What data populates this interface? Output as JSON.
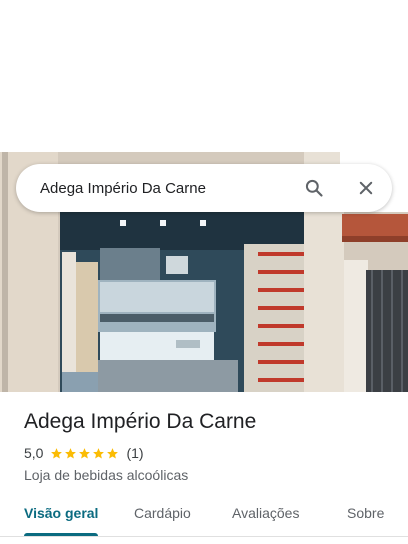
{
  "search": {
    "query": "Adega Império Da Carne"
  },
  "place": {
    "title": "Adega Império Da Carne",
    "rating": "5,0",
    "stars": 5,
    "review_count": "(1)",
    "category": "Loja de bebidas alcoólicas"
  },
  "tabs": [
    {
      "label": "Visão geral",
      "active": true
    },
    {
      "label": "Cardápio",
      "active": false
    },
    {
      "label": "Avaliações",
      "active": false
    },
    {
      "label": "Sobre",
      "active": false
    }
  ],
  "colors": {
    "accent": "#0b6b80",
    "star": "#fbbc04"
  },
  "icons": {
    "search": "search-icon",
    "close": "close-icon",
    "star": "star-icon"
  }
}
